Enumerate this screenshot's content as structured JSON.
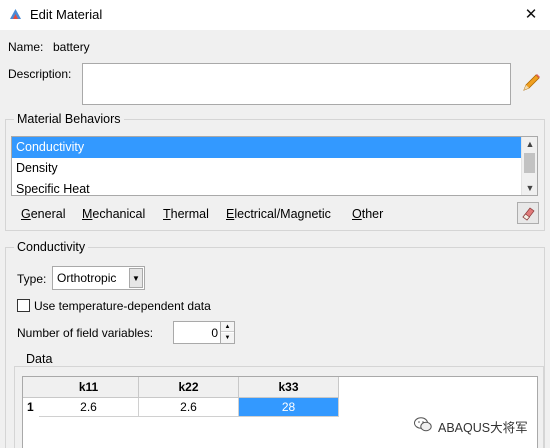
{
  "window": {
    "title": "Edit Material",
    "close_glyph": "✕"
  },
  "material": {
    "name_label": "Name:",
    "name_value": "battery",
    "description_label": "Description:",
    "description_value": ""
  },
  "behaviors": {
    "group_title": "Material Behaviors",
    "items": [
      {
        "label": "Conductivity",
        "selected": true
      },
      {
        "label": "Density",
        "selected": false
      },
      {
        "label": "Specific Heat",
        "selected": false
      }
    ],
    "menus": [
      "General",
      "Mechanical",
      "Thermal",
      "Electrical/Magnetic",
      "Other"
    ],
    "menu_mnemonics": [
      "G",
      "M",
      "T",
      "E",
      "O"
    ]
  },
  "conductivity": {
    "group_title": "Conductivity",
    "type_label": "Type:",
    "type_value": "Orthotropic",
    "temp_dependent_label": "Use temperature-dependent data",
    "temp_dependent_checked": false,
    "field_vars_label": "Number of field variables:",
    "field_vars_value": "0"
  },
  "data_table": {
    "group_title": "Data",
    "columns": [
      "k11",
      "k22",
      "k33"
    ],
    "rows": [
      {
        "index": "1",
        "cells": [
          "2.6",
          "2.6",
          "28"
        ]
      }
    ],
    "selected_cell": 2
  },
  "watermark": {
    "text": "ABAQUS大将军"
  },
  "icons": {
    "app": "abaqus-app-icon",
    "edit_description": "pencil-icon",
    "delete_behavior": "eraser-icon",
    "wechat": "wechat-icon"
  },
  "colors": {
    "selection": "#3399ff",
    "background": "#f0f0f0"
  }
}
